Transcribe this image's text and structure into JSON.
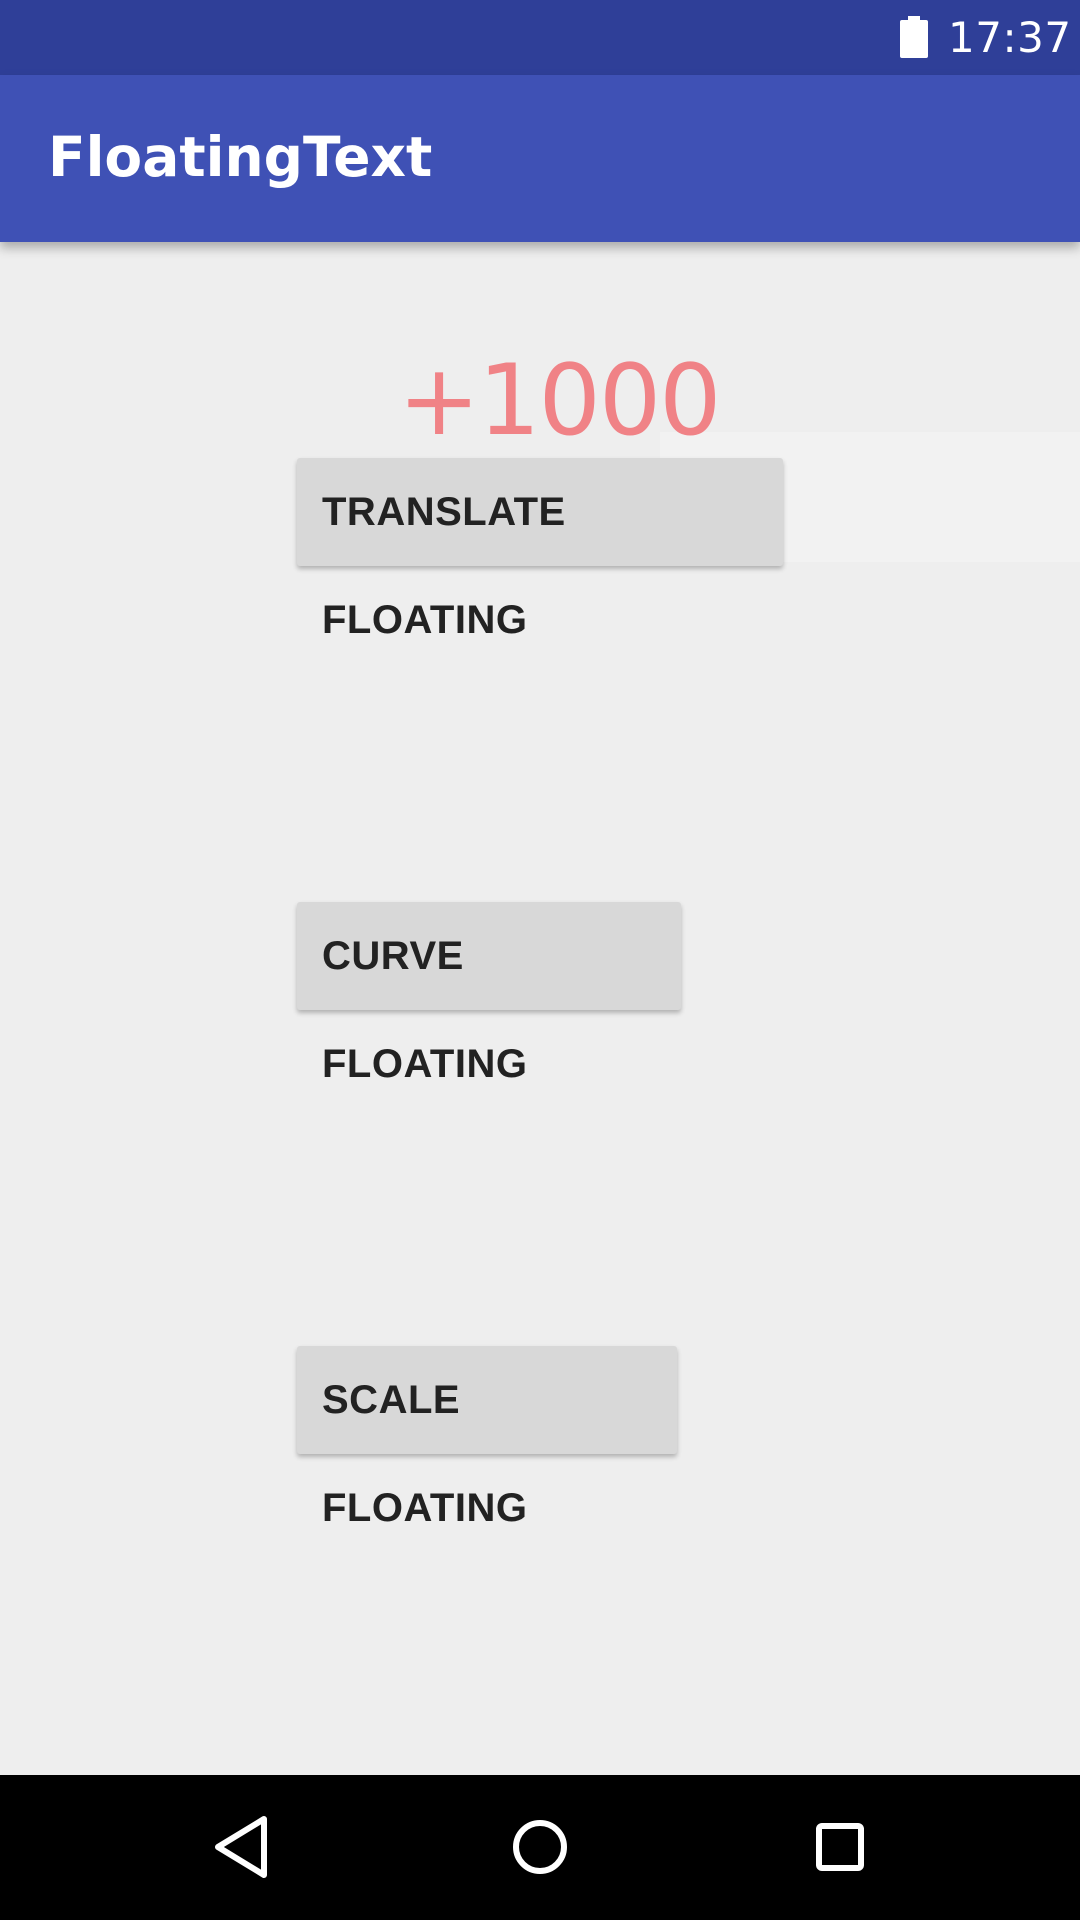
{
  "status_bar": {
    "time": "17:37",
    "battery_icon": "battery-full-icon",
    "background": "#2f3f98"
  },
  "app_bar": {
    "title": "FloatingText",
    "background": "#3f51b5"
  },
  "content": {
    "floating_text": "+1000",
    "floating_text_color": "#f08286",
    "background": "#eeeeee",
    "buttons": {
      "translate": "TRANSLATE FLOATING",
      "curve": "CURVE FLOATING",
      "scale": "SCALE FLOATING"
    }
  },
  "nav_bar": {
    "back_icon": "back-triangle-icon",
    "home_icon": "home-circle-icon",
    "recents_icon": "recents-square-icon"
  }
}
